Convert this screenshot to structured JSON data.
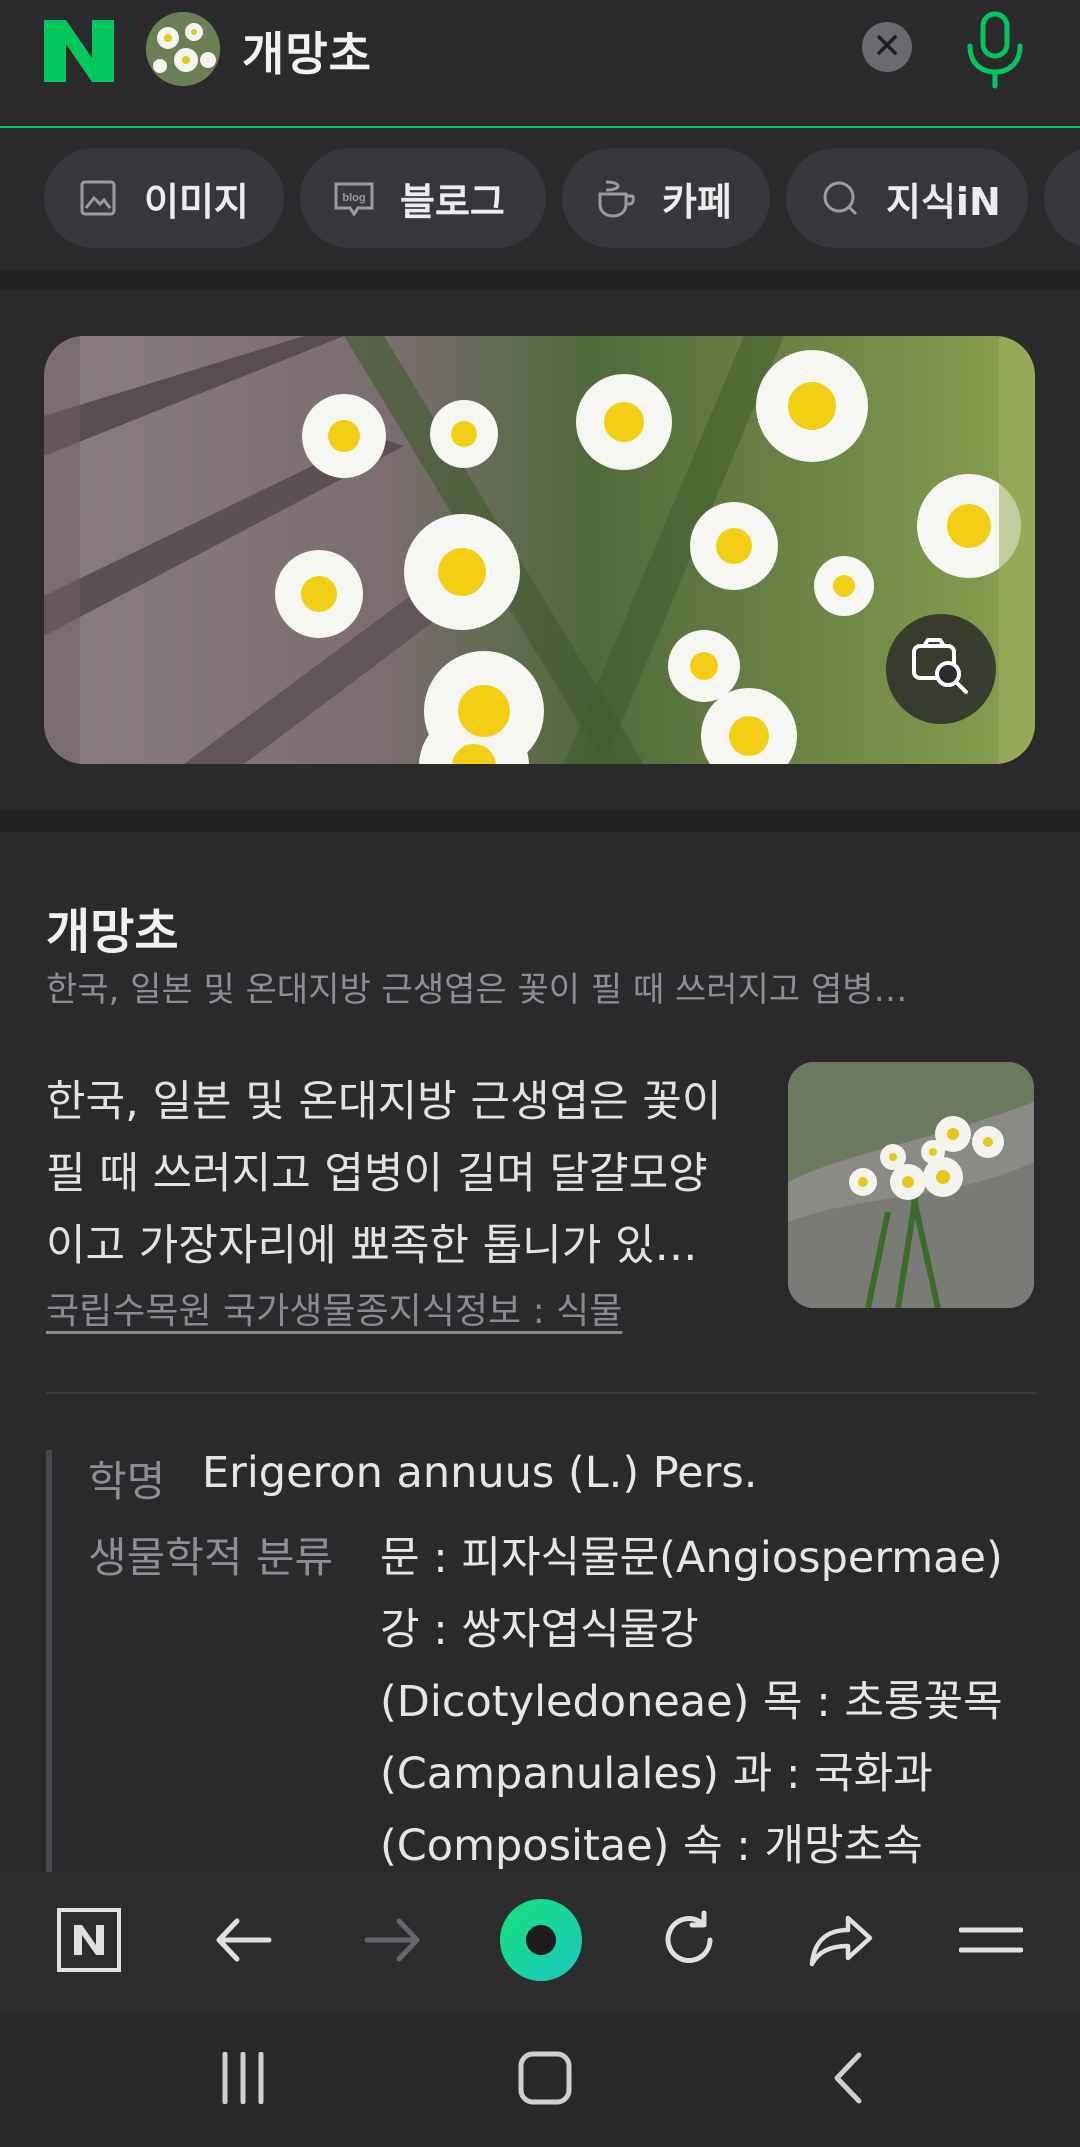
{
  "header": {
    "logo_letter": "N",
    "query": "개망초",
    "clear_icon": "close-icon",
    "mic_icon": "mic-icon",
    "accent_color": "#03c75a"
  },
  "tabs": [
    {
      "label": "이미지",
      "icon": "image-icon"
    },
    {
      "label": "블로그",
      "icon": "blog-icon"
    },
    {
      "label": "카페",
      "icon": "cafe-cup-icon"
    },
    {
      "label": "지식iN",
      "icon": "knowledge-icon"
    }
  ],
  "hero": {
    "alt": "daisy-flowers-photo",
    "lens_icon": "image-search-icon"
  },
  "info": {
    "title": "개망초",
    "subtitle": "한국, 일본 및 온대지방 근생엽은 꽃이 필 때 쓰러지고 엽병…",
    "description": "한국, 일본 및 온대지방 근생엽은 꽃이 필 때 쓰러지고 엽병이 길며 달걀모양이고 가장자리에 뾰족한 톱니가 있…",
    "source": "국립수목원 국가생물종지식정보 : 식물",
    "scientific_name_label": "학명",
    "scientific_name": "Erigeron annuus (L.) Pers.",
    "classification_label": "생물학적 분류",
    "classification": "문 : 피자식물문(Angiospermae) 강 : 쌍자엽식물강 (Dicotyledoneae) 목 : 초롱꽃목 (Campanulales) 과 : 국화과 (Compositae) 속 : 개망초속"
  },
  "toolbar": {
    "home_letter": "N",
    "items": [
      "home-n-icon",
      "back-arrow-icon",
      "forward-arrow-icon",
      "green-dot-icon",
      "refresh-icon",
      "share-icon",
      "menu-icon"
    ],
    "green_dot_color": "#19d38a"
  },
  "system_nav": [
    "recent-apps-icon",
    "home-icon",
    "back-icon"
  ]
}
